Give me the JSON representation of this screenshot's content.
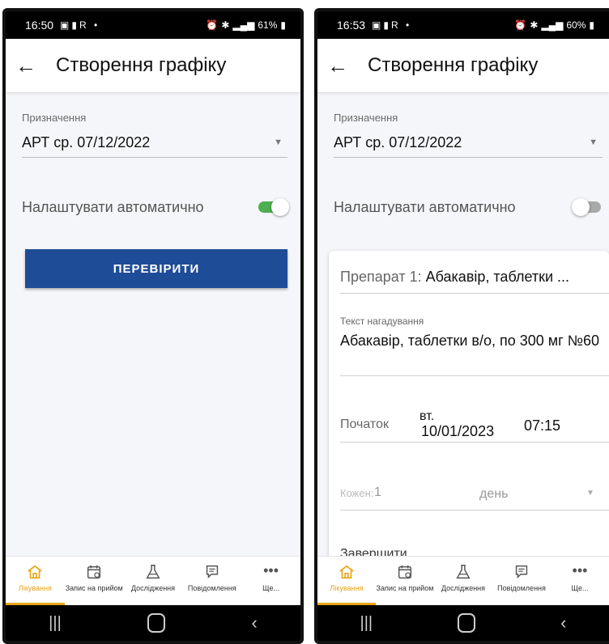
{
  "screens": [
    {
      "status": {
        "time": "16:50",
        "battery": "61%"
      },
      "app_bar": {
        "title": "Створення графіку"
      },
      "purpose": {
        "label": "Призначення",
        "value": "АРТ ср. 07/12/2022"
      },
      "auto_toggle": {
        "label": "Налаштувати автоматично",
        "state": "on"
      },
      "check_button": "ПЕРЕВІРИТИ"
    },
    {
      "status": {
        "time": "16:53",
        "battery": "60%"
      },
      "app_bar": {
        "title": "Створення графіку"
      },
      "purpose": {
        "label": "Призначення",
        "value": "АРТ ср. 07/12/2022"
      },
      "auto_toggle": {
        "label": "Налаштувати автоматично",
        "state": "off"
      },
      "card": {
        "drug_label": "Препарат 1:",
        "drug_value": "Абакавір, таблетки ...",
        "reminder_label": "Текст нагадування",
        "reminder_value": "Абакавір, таблетки в/о, по 300 мг №60",
        "start_label": "Початок",
        "start_day": "вт.",
        "start_date": "10/01/2023",
        "start_time": "07:15",
        "every_label": "Кожен:",
        "every_value": "1",
        "every_unit": "день",
        "finish_label": "Завершити"
      }
    }
  ],
  "nav": [
    {
      "label": "Лікування",
      "icon": "home-icon"
    },
    {
      "label": "Запис на прийом",
      "icon": "calendar-icon"
    },
    {
      "label": "Дослідження",
      "icon": "flask-icon"
    },
    {
      "label": "Повідомлення",
      "icon": "message-icon"
    },
    {
      "label": "Ще...",
      "icon": "more-icon"
    }
  ],
  "colors": {
    "accent": "#e8a317",
    "primary_button": "#1f4c97",
    "toggle_on": "#4caf50"
  }
}
